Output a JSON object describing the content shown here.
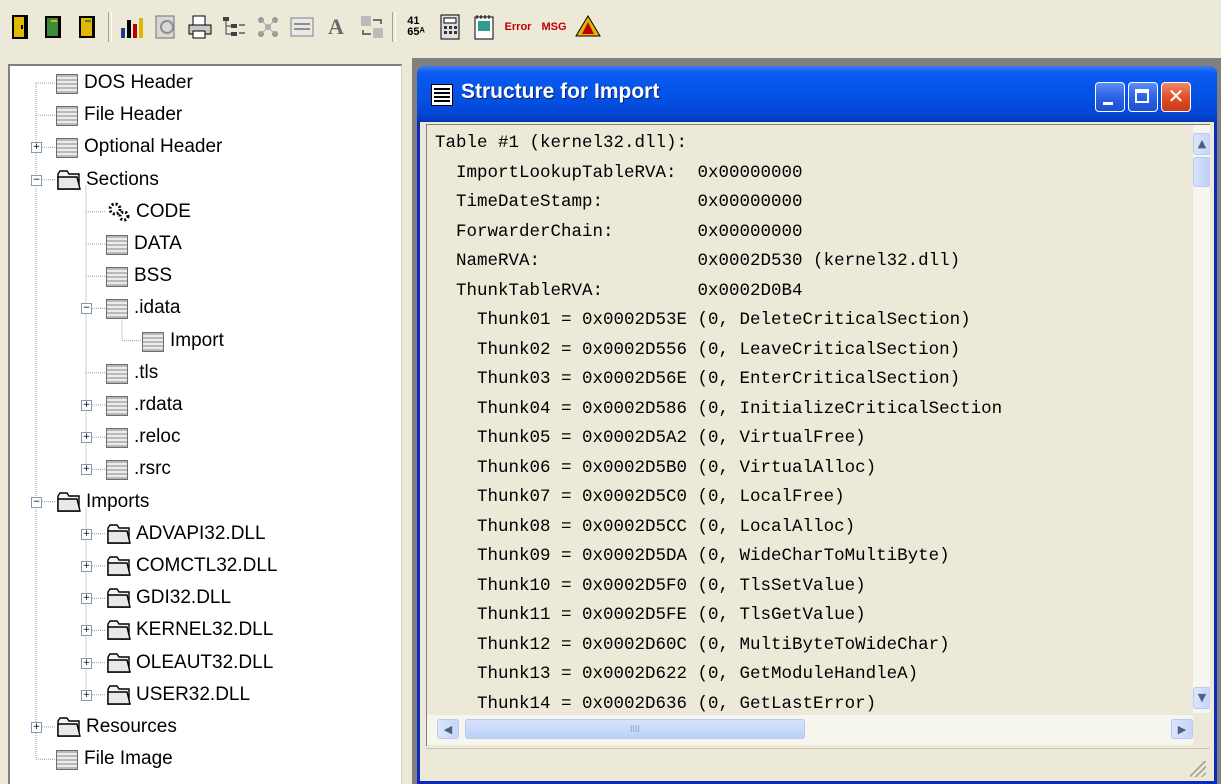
{
  "toolbar": {
    "buttons": [
      {
        "name": "exit-door-icon",
        "color": "#d8b400"
      },
      {
        "name": "open-book-icon",
        "color": "#3c8a3c"
      },
      {
        "name": "close-book-icon",
        "color": "#d8b400"
      },
      {
        "name": "bar-chart-icon",
        "color": "#1c3c8c"
      },
      {
        "name": "dump-icon",
        "color": "#808080"
      },
      {
        "name": "print-icon",
        "color": "#606060"
      },
      {
        "name": "tree-view-icon",
        "color": "#404040"
      },
      {
        "name": "network-icon",
        "color": "#808080"
      },
      {
        "name": "hex-view-icon",
        "color": "#808080"
      },
      {
        "name": "font-icon",
        "label": "A",
        "color": "#6a6a6a"
      },
      {
        "name": "compare-icon",
        "color": "#808080"
      },
      {
        "name": "convert-numbers-icon",
        "label": "41\n65ᴬ",
        "color": "#000000"
      },
      {
        "name": "calculator-icon",
        "color": "#404040"
      },
      {
        "name": "notepad-icon",
        "color": "#2a9d8f"
      },
      {
        "name": "error-lookup-icon",
        "label": "Error",
        "color": "#c00000"
      },
      {
        "name": "message-lookup-icon",
        "label": "MSG",
        "color": "#c00000"
      },
      {
        "name": "help-icon",
        "color": "#d8b400"
      }
    ]
  },
  "tree": {
    "nodes": [
      {
        "label": "DOS Header",
        "icon": "box",
        "depth": 0,
        "expander": ""
      },
      {
        "label": "File Header",
        "icon": "box",
        "depth": 0,
        "expander": ""
      },
      {
        "label": "Optional Header",
        "icon": "box",
        "depth": 0,
        "expander": "+"
      },
      {
        "label": "Sections",
        "icon": "folder",
        "depth": 0,
        "expander": "−"
      },
      {
        "label": "CODE",
        "icon": "gear",
        "depth": 1,
        "expander": ""
      },
      {
        "label": "DATA",
        "icon": "box",
        "depth": 1,
        "expander": ""
      },
      {
        "label": "BSS",
        "icon": "box",
        "depth": 1,
        "expander": ""
      },
      {
        "label": ".idata",
        "icon": "box",
        "depth": 1,
        "expander": "−"
      },
      {
        "label": "Import",
        "icon": "box",
        "depth": 2,
        "expander": "",
        "selected": true
      },
      {
        "label": ".tls",
        "icon": "box",
        "depth": 1,
        "expander": ""
      },
      {
        "label": ".rdata",
        "icon": "box",
        "depth": 1,
        "expander": "+"
      },
      {
        "label": ".reloc",
        "icon": "box",
        "depth": 1,
        "expander": "+"
      },
      {
        "label": ".rsrc",
        "icon": "box",
        "depth": 1,
        "expander": "+"
      },
      {
        "label": "Imports",
        "icon": "folder",
        "depth": 0,
        "expander": "−"
      },
      {
        "label": "ADVAPI32.DLL",
        "icon": "folder",
        "depth": 1,
        "expander": "+"
      },
      {
        "label": "COMCTL32.DLL",
        "icon": "folder",
        "depth": 1,
        "expander": "+"
      },
      {
        "label": "GDI32.DLL",
        "icon": "folder",
        "depth": 1,
        "expander": "+"
      },
      {
        "label": "KERNEL32.DLL",
        "icon": "folder",
        "depth": 1,
        "expander": "+"
      },
      {
        "label": "OLEAUT32.DLL",
        "icon": "folder",
        "depth": 1,
        "expander": "+"
      },
      {
        "label": "USER32.DLL",
        "icon": "folder",
        "depth": 1,
        "expander": "+"
      },
      {
        "label": "Resources",
        "icon": "folder",
        "depth": 0,
        "expander": "+"
      },
      {
        "label": "File Image",
        "icon": "box",
        "depth": 0,
        "expander": ""
      }
    ]
  },
  "window": {
    "title": "Structure for Import",
    "minimize_icon": "minimize-icon",
    "maximize_icon": "maximize-icon",
    "close_label": "✕",
    "lines": [
      "Table #1 (kernel32.dll):",
      "  ImportLookupTableRVA:  0x00000000",
      "  TimeDateStamp:         0x00000000",
      "  ForwarderChain:        0x00000000",
      "  NameRVA:               0x0002D530 (kernel32.dll)",
      "  ThunkTableRVA:         0x0002D0B4",
      "    Thunk01 = 0x0002D53E (0, DeleteCriticalSection)",
      "    Thunk02 = 0x0002D556 (0, LeaveCriticalSection)",
      "    Thunk03 = 0x0002D56E (0, EnterCriticalSection)",
      "    Thunk04 = 0x0002D586 (0, InitializeCriticalSection",
      "    Thunk05 = 0x0002D5A2 (0, VirtualFree)",
      "    Thunk06 = 0x0002D5B0 (0, VirtualAlloc)",
      "    Thunk07 = 0x0002D5C0 (0, LocalFree)",
      "    Thunk08 = 0x0002D5CC (0, LocalAlloc)",
      "    Thunk09 = 0x0002D5DA (0, WideCharToMultiByte)",
      "    Thunk10 = 0x0002D5F0 (0, TlsSetValue)",
      "    Thunk11 = 0x0002D5FE (0, TlsGetValue)",
      "    Thunk12 = 0x0002D60C (0, MultiByteToWideChar)",
      "    Thunk13 = 0x0002D622 (0, GetModuleHandleA)",
      "    Thunk14 = 0x0002D636 (0, GetLastError)"
    ]
  },
  "scrollbars": {
    "vertical_up": "▲",
    "vertical_down": "▼",
    "horizontal_left": "◀",
    "horizontal_right": "▶",
    "thumb_grip": "IIII"
  }
}
